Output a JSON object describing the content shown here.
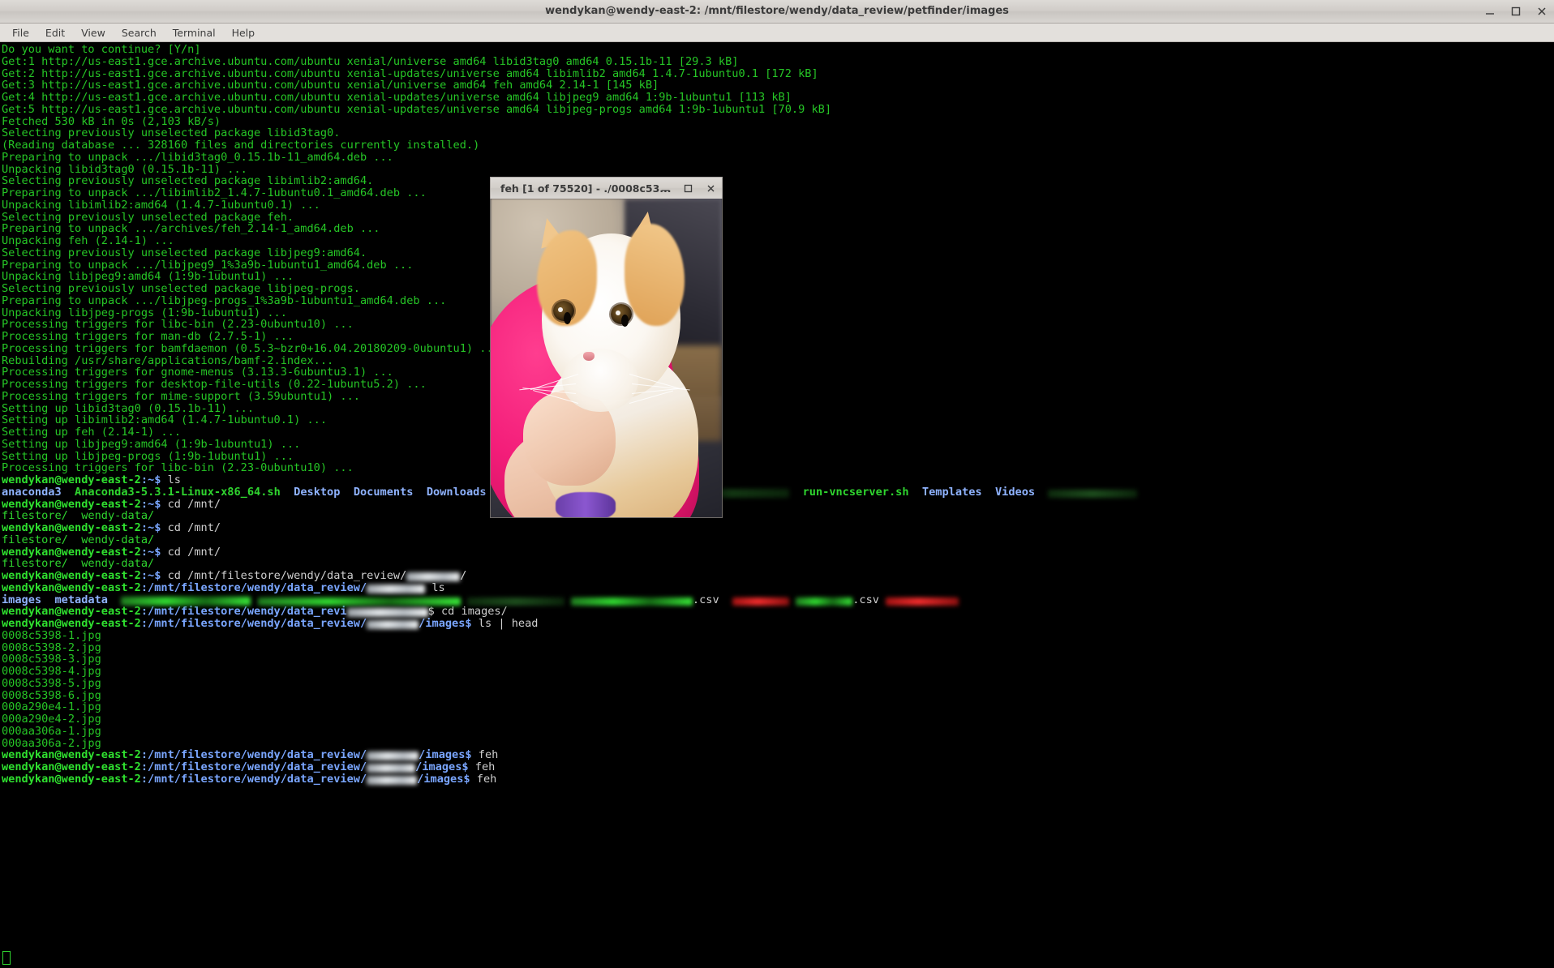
{
  "window": {
    "title": "wendykan@wendy-east-2: /mnt/filestore/wendy/data_review/petfinder/images",
    "buttons": {
      "minimize": "minimize-button",
      "maximize": "maximize-button",
      "close": "close-button"
    }
  },
  "menubar": {
    "items": [
      {
        "label": "File"
      },
      {
        "label": "Edit"
      },
      {
        "label": "View"
      },
      {
        "label": "Search"
      },
      {
        "label": "Terminal"
      },
      {
        "label": "Help"
      }
    ]
  },
  "feh_window": {
    "title": "feh [1 of 75520] - ./0008c53...",
    "index": 1,
    "total": 75520,
    "file": "./0008c53...",
    "buttons": {
      "minimize": "minimize-button",
      "maximize": "maximize-button",
      "close": "close-button"
    },
    "image_description": "photo of a white and ginger cat held against a pink shirt"
  },
  "terminal": {
    "prompt_user": "wendykan@wendy-east-2",
    "lines": [
      {
        "t": "Do you want to continue? [Y/n]"
      },
      {
        "t": "Get:1 http://us-east1.gce.archive.ubuntu.com/ubuntu xenial/universe amd64 libid3tag0 amd64 0.15.1b-11 [29.3 kB]"
      },
      {
        "t": "Get:2 http://us-east1.gce.archive.ubuntu.com/ubuntu xenial-updates/universe amd64 libimlib2 amd64 1.4.7-1ubuntu0.1 [172 kB]"
      },
      {
        "t": "Get:3 http://us-east1.gce.archive.ubuntu.com/ubuntu xenial/universe amd64 feh amd64 2.14-1 [145 kB]"
      },
      {
        "t": "Get:4 http://us-east1.gce.archive.ubuntu.com/ubuntu xenial-updates/universe amd64 libjpeg9 amd64 1:9b-1ubuntu1 [113 kB]"
      },
      {
        "t": "Get:5 http://us-east1.gce.archive.ubuntu.com/ubuntu xenial-updates/universe amd64 libjpeg-progs amd64 1:9b-1ubuntu1 [70.9 kB]"
      },
      {
        "t": "Fetched 530 kB in 0s (2,103 kB/s)"
      },
      {
        "t": "Selecting previously unselected package libid3tag0."
      },
      {
        "t": "(Reading database ... 328160 files and directories currently installed.)"
      },
      {
        "t": "Preparing to unpack .../libid3tag0_0.15.1b-11_amd64.deb ..."
      },
      {
        "t": "Unpacking libid3tag0 (0.15.1b-11) ..."
      },
      {
        "t": "Selecting previously unselected package libimlib2:amd64."
      },
      {
        "t": "Preparing to unpack .../libimlib2_1.4.7-1ubuntu0.1_amd64.deb ..."
      },
      {
        "t": "Unpacking libimlib2:amd64 (1.4.7-1ubuntu0.1) ..."
      },
      {
        "t": "Selecting previously unselected package feh."
      },
      {
        "t": "Preparing to unpack .../archives/feh_2.14-1_amd64.deb ..."
      },
      {
        "t": "Unpacking feh (2.14-1) ..."
      },
      {
        "t": "Selecting previously unselected package libjpeg9:amd64."
      },
      {
        "t": "Preparing to unpack .../libjpeg9_1%3a9b-1ubuntu1_amd64.deb ..."
      },
      {
        "t": "Unpacking libjpeg9:amd64 (1:9b-1ubuntu1) ..."
      },
      {
        "t": "Selecting previously unselected package libjpeg-progs."
      },
      {
        "t": "Preparing to unpack .../libjpeg-progs_1%3a9b-1ubuntu1_amd64.deb ..."
      },
      {
        "t": "Unpacking libjpeg-progs (1:9b-1ubuntu1) ..."
      },
      {
        "t": "Processing triggers for libc-bin (2.23-0ubuntu10) ..."
      },
      {
        "t": "Processing triggers for man-db (2.7.5-1) ..."
      },
      {
        "t": "Processing triggers for bamfdaemon (0.5.3~bzr0+16.04.20180209-0ubuntu1) ..."
      },
      {
        "t": "Rebuilding /usr/share/applications/bamf-2.index..."
      },
      {
        "t": "Processing triggers for gnome-menus (3.13.3-6ubuntu3.1) ..."
      },
      {
        "t": "Processing triggers for desktop-file-utils (0.22-1ubuntu5.2) ..."
      },
      {
        "t": "Processing triggers for mime-support (3.59ubuntu1) ..."
      },
      {
        "t": "Setting up libid3tag0 (0.15.1b-11) ..."
      },
      {
        "t": "Setting up libimlib2:amd64 (1.4.7-1ubuntu0.1) ..."
      },
      {
        "t": "Setting up feh (2.14-1) ..."
      },
      {
        "t": "Setting up libjpeg9:amd64 (1:9b-1ubuntu1) ..."
      },
      {
        "t": "Setting up libjpeg-progs (1:9b-1ubuntu1) ..."
      },
      {
        "t": "Processing triggers for libc-bin (2.23-0ubuntu10) ..."
      }
    ],
    "prompts": [
      {
        "host": "wendykan@wendy-east-2",
        "path": ":~$",
        "cmd": " ls"
      },
      {
        "host": "wendykan@wendy-east-2",
        "path": ":~$",
        "cmd": " cd /mnt/"
      },
      {
        "host": "wendykan@wendy-east-2",
        "path": ":~$",
        "cmd": " cd /mnt/"
      },
      {
        "host": "wendykan@wendy-east-2",
        "path": ":~$",
        "cmd": " cd /mnt/"
      }
    ],
    "ls_home": {
      "dirs": [
        "anaconda3",
        "Desktop",
        "Documents",
        "Downloads",
        "Templates",
        "Videos"
      ],
      "execs": [
        "Anaconda3-5.3.1-Linux-x86_64.sh",
        "mount-w",
        "run-vncserver.sh"
      ]
    },
    "ls_mnt": "filestore/  wendy-data/",
    "cd_review_cmd": " cd /mnt/filestore/wendy/data_review/",
    "prompt_review_path": ":/mnt/filestore/wendy/data_review/",
    "ls_review": "images  metadata",
    "cd_images_cmd": "$ cd images/",
    "prompt_images_path": ":/mnt/filestore/wendy/data_review/",
    "images_suffix": "/images$",
    "ls_head_cmd": " ls | head",
    "jpg_files": [
      "0008c5398-1.jpg",
      "0008c5398-2.jpg",
      "0008c5398-3.jpg",
      "0008c5398-4.jpg",
      "0008c5398-5.jpg",
      "0008c5398-6.jpg",
      "000a290e4-1.jpg",
      "000a290e4-2.jpg",
      "000aa306a-1.jpg",
      "000aa306a-2.jpg"
    ],
    "feh_cmd": " feh"
  },
  "colors": {
    "terminal_bg": "#000000",
    "terminal_fg": "#2fd62f",
    "prompt_user": "#2fe02f",
    "prompt_path": "#7aa6ff",
    "dir_blue": "#8fb3ff",
    "titlebar": "#d5d1cd"
  }
}
